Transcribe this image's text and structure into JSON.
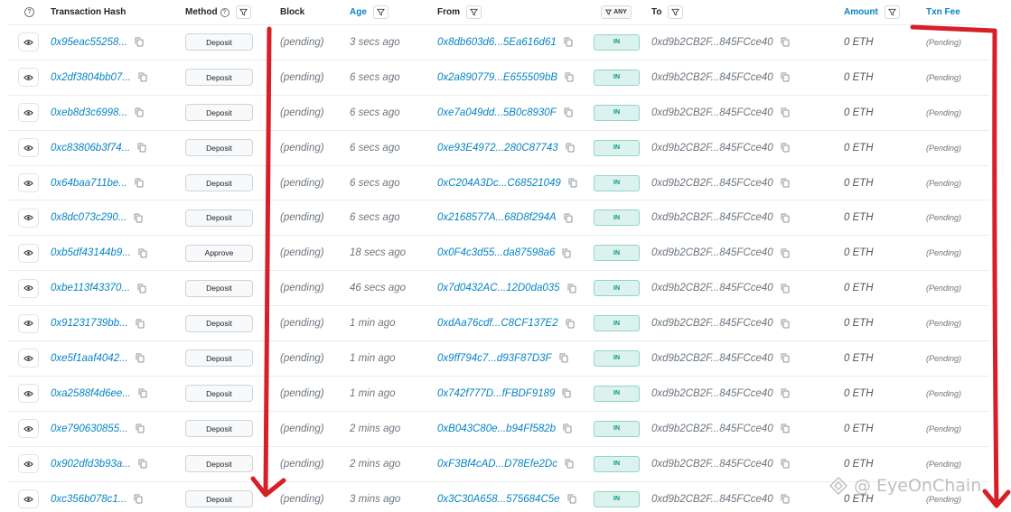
{
  "header": {
    "help_icon": "question-circle-icon",
    "hash": "Transaction Hash",
    "method": "Method",
    "block": "Block",
    "age": "Age",
    "from": "From",
    "direction_filter": "ANY",
    "to": "To",
    "amount": "Amount",
    "fee": "Txn Fee"
  },
  "rows": [
    {
      "hash": "0x95eac55258...",
      "method": "Deposit",
      "block": "(pending)",
      "age": "3 secs ago",
      "from": "0x8db603d6...5Ea616d61",
      "dir": "IN",
      "to": "0xd9b2CB2F...845FCce40",
      "amount": "0 ETH",
      "fee": "(Pending)"
    },
    {
      "hash": "0x2df3804bb07...",
      "method": "Deposit",
      "block": "(pending)",
      "age": "6 secs ago",
      "from": "0x2a890779...E655509bB",
      "dir": "IN",
      "to": "0xd9b2CB2F...845FCce40",
      "amount": "0 ETH",
      "fee": "(Pending)"
    },
    {
      "hash": "0xeb8d3c6998...",
      "method": "Deposit",
      "block": "(pending)",
      "age": "6 secs ago",
      "from": "0xe7a049dd...5B0c8930F",
      "dir": "IN",
      "to": "0xd9b2CB2F...845FCce40",
      "amount": "0 ETH",
      "fee": "(Pending)"
    },
    {
      "hash": "0xc83806b3f74...",
      "method": "Deposit",
      "block": "(pending)",
      "age": "6 secs ago",
      "from": "0xe93E4972...280C87743",
      "dir": "IN",
      "to": "0xd9b2CB2F...845FCce40",
      "amount": "0 ETH",
      "fee": "(Pending)"
    },
    {
      "hash": "0x64baa711be...",
      "method": "Deposit",
      "block": "(pending)",
      "age": "6 secs ago",
      "from": "0xC204A3Dc...C68521049",
      "dir": "IN",
      "to": "0xd9b2CB2F...845FCce40",
      "amount": "0 ETH",
      "fee": "(Pending)"
    },
    {
      "hash": "0x8dc073c290...",
      "method": "Deposit",
      "block": "(pending)",
      "age": "6 secs ago",
      "from": "0x2168577A...68D8f294A",
      "dir": "IN",
      "to": "0xd9b2CB2F...845FCce40",
      "amount": "0 ETH",
      "fee": "(Pending)"
    },
    {
      "hash": "0xb5df43144b9...",
      "method": "Approve",
      "block": "(pending)",
      "age": "18 secs ago",
      "from": "0x0F4c3d55...da87598a6",
      "dir": "IN",
      "to": "0xd9b2CB2F...845FCce40",
      "amount": "0 ETH",
      "fee": "(Pending)"
    },
    {
      "hash": "0xbe113f43370...",
      "method": "Deposit",
      "block": "(pending)",
      "age": "46 secs ago",
      "from": "0x7d0432AC...12D0da035",
      "dir": "IN",
      "to": "0xd9b2CB2F...845FCce40",
      "amount": "0 ETH",
      "fee": "(Pending)"
    },
    {
      "hash": "0x91231739bb...",
      "method": "Deposit",
      "block": "(pending)",
      "age": "1 min ago",
      "from": "0xdAa76cdf...C8CF137E2",
      "dir": "IN",
      "to": "0xd9b2CB2F...845FCce40",
      "amount": "0 ETH",
      "fee": "(Pending)"
    },
    {
      "hash": "0xe5f1aaf4042...",
      "method": "Deposit",
      "block": "(pending)",
      "age": "1 min ago",
      "from": "0x9ff794c7...d93F87D3F",
      "dir": "IN",
      "to": "0xd9b2CB2F...845FCce40",
      "amount": "0 ETH",
      "fee": "(Pending)"
    },
    {
      "hash": "0xa2588f4d6ee...",
      "method": "Deposit",
      "block": "(pending)",
      "age": "1 min ago",
      "from": "0x742f777D...fFBDF9189",
      "dir": "IN",
      "to": "0xd9b2CB2F...845FCce40",
      "amount": "0 ETH",
      "fee": "(Pending)"
    },
    {
      "hash": "0xe790630855...",
      "method": "Deposit",
      "block": "(pending)",
      "age": "2 mins ago",
      "from": "0xB043C80e...b94Ff582b",
      "dir": "IN",
      "to": "0xd9b2CB2F...845FCce40",
      "amount": "0 ETH",
      "fee": "(Pending)"
    },
    {
      "hash": "0x902dfd3b93a...",
      "method": "Deposit",
      "block": "(pending)",
      "age": "2 mins ago",
      "from": "0xF3Bf4cAD...D78Efe2Dc",
      "dir": "IN",
      "to": "0xd9b2CB2F...845FCce40",
      "amount": "0 ETH",
      "fee": "(Pending)"
    },
    {
      "hash": "0xc356b078c1...",
      "method": "Deposit",
      "block": "(pending)",
      "age": "3 mins ago",
      "from": "0x3C30A658...575684C5e",
      "dir": "IN",
      "to": "0xd9b2CB2F...845FCce40",
      "amount": "0 ETH",
      "fee": "(Pending)"
    }
  ],
  "watermark": "@ EyeOnChain",
  "colors": {
    "link": "#0784c3",
    "in_badge_bg": "#dbf2ee",
    "in_badge_text": "#02977e",
    "annotation": "#d61f26"
  }
}
